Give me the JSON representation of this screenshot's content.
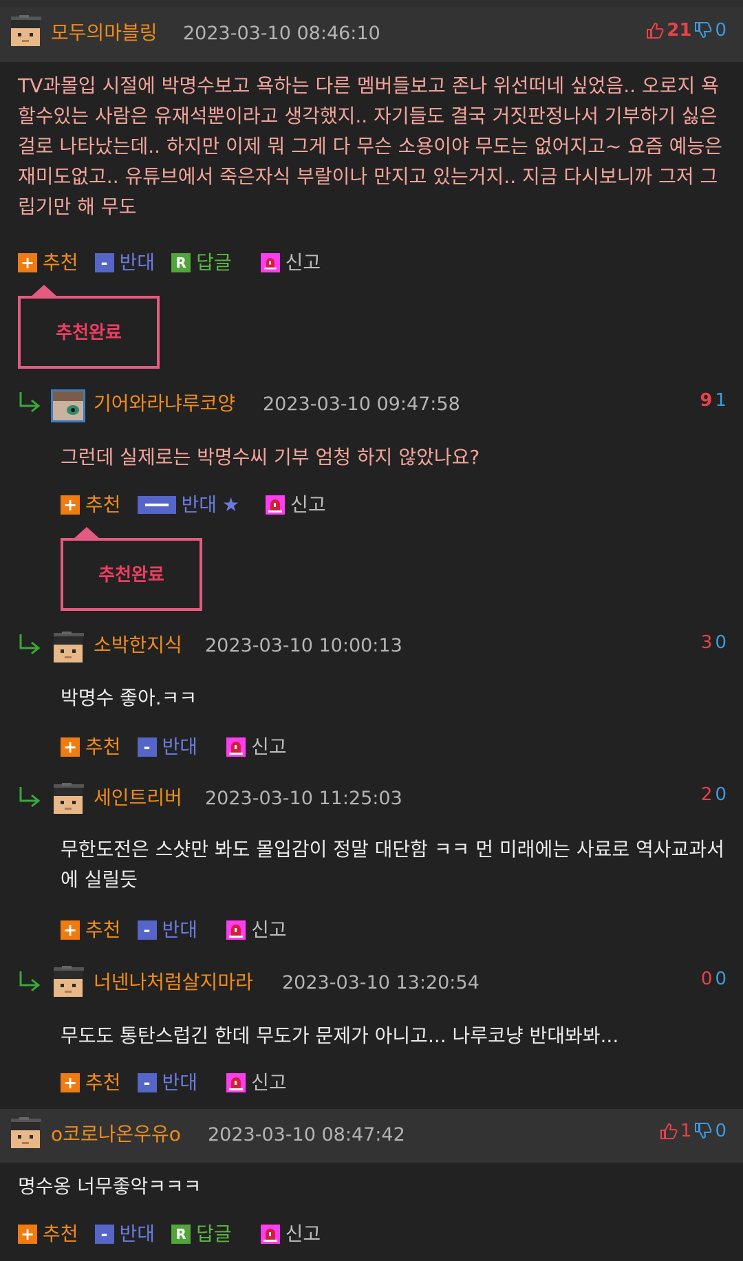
{
  "comments": [
    {
      "nick": "모두의마블링",
      "date": "2023-03-10 08:46:10",
      "likes": "21",
      "dislikes": "0",
      "text": "TV과몰입 시절에 박명수보고 욕하는 다른 멤버들보고 존나 위선떠네 싶었음.. 오로지 욕할수있는 사람은 유재석뿐이라고 생각했지.. 자기들도 결국 거짓판정나서 기부하기 싫은걸로 나타났는데.. 하지만 이제 뭐 그게 다 무슨 소용이야 무도는 없어지고~ 요즘 예능은 재미도없고.. 유튜브에서 죽은자식 부랄이나 만지고 있는거지.. 지금 다시보니까 그저 그립기만 해 무도"
    },
    {
      "nick": "기어와라냐루코양",
      "date": "2023-03-10 09:47:58",
      "likes": "9",
      "dislikes": "1",
      "text": "그런데 실제로는 박명수씨 기부 엄청 하지 않았나요?"
    },
    {
      "nick": "소박한지식",
      "date": "2023-03-10 10:00:13",
      "likes": "3",
      "dislikes": "0",
      "text": "박명수 좋아.ㅋㅋ"
    },
    {
      "nick": "세인트리버",
      "date": "2023-03-10 11:25:03",
      "likes": "2",
      "dislikes": "0",
      "text": "무한도전은 스샷만 봐도 몰입감이 정말 대단함 ㅋㅋ 먼 미래에는 사료로 역사교과서에 실릴듯"
    },
    {
      "nick": "너넨나처럼살지마라",
      "date": "2023-03-10 13:20:54",
      "likes": "0",
      "dislikes": "0",
      "text": "무도도 통탄스럽긴 한데 무도가 문제가 아니고... 나루코냥 반대봐봐..."
    },
    {
      "nick": "o코로나온우유o",
      "date": "2023-03-10 08:47:42",
      "likes": "1",
      "dislikes": "0",
      "text": "명수옹 너무좋악ㅋㅋㅋ"
    }
  ],
  "actions": {
    "recommend": "추천",
    "oppose": "반대",
    "reply": "답글",
    "report": "신고",
    "star": "★",
    "plus": "+",
    "minus": "-",
    "reply_icon": "R"
  },
  "badge_text": "추천완료",
  "colors": {
    "nick": "#f08c1a",
    "like": "#e8424a",
    "dislike": "#3b9be0",
    "badge": "#e55a80",
    "reply_arrow": "#3aa83a"
  },
  "icons": [
    "avatar-icon",
    "thumbs-up-icon",
    "thumbs-down-icon",
    "reply-arrow-icon",
    "plus-icon",
    "minus-icon",
    "reply-icon",
    "report-siren-icon"
  ]
}
